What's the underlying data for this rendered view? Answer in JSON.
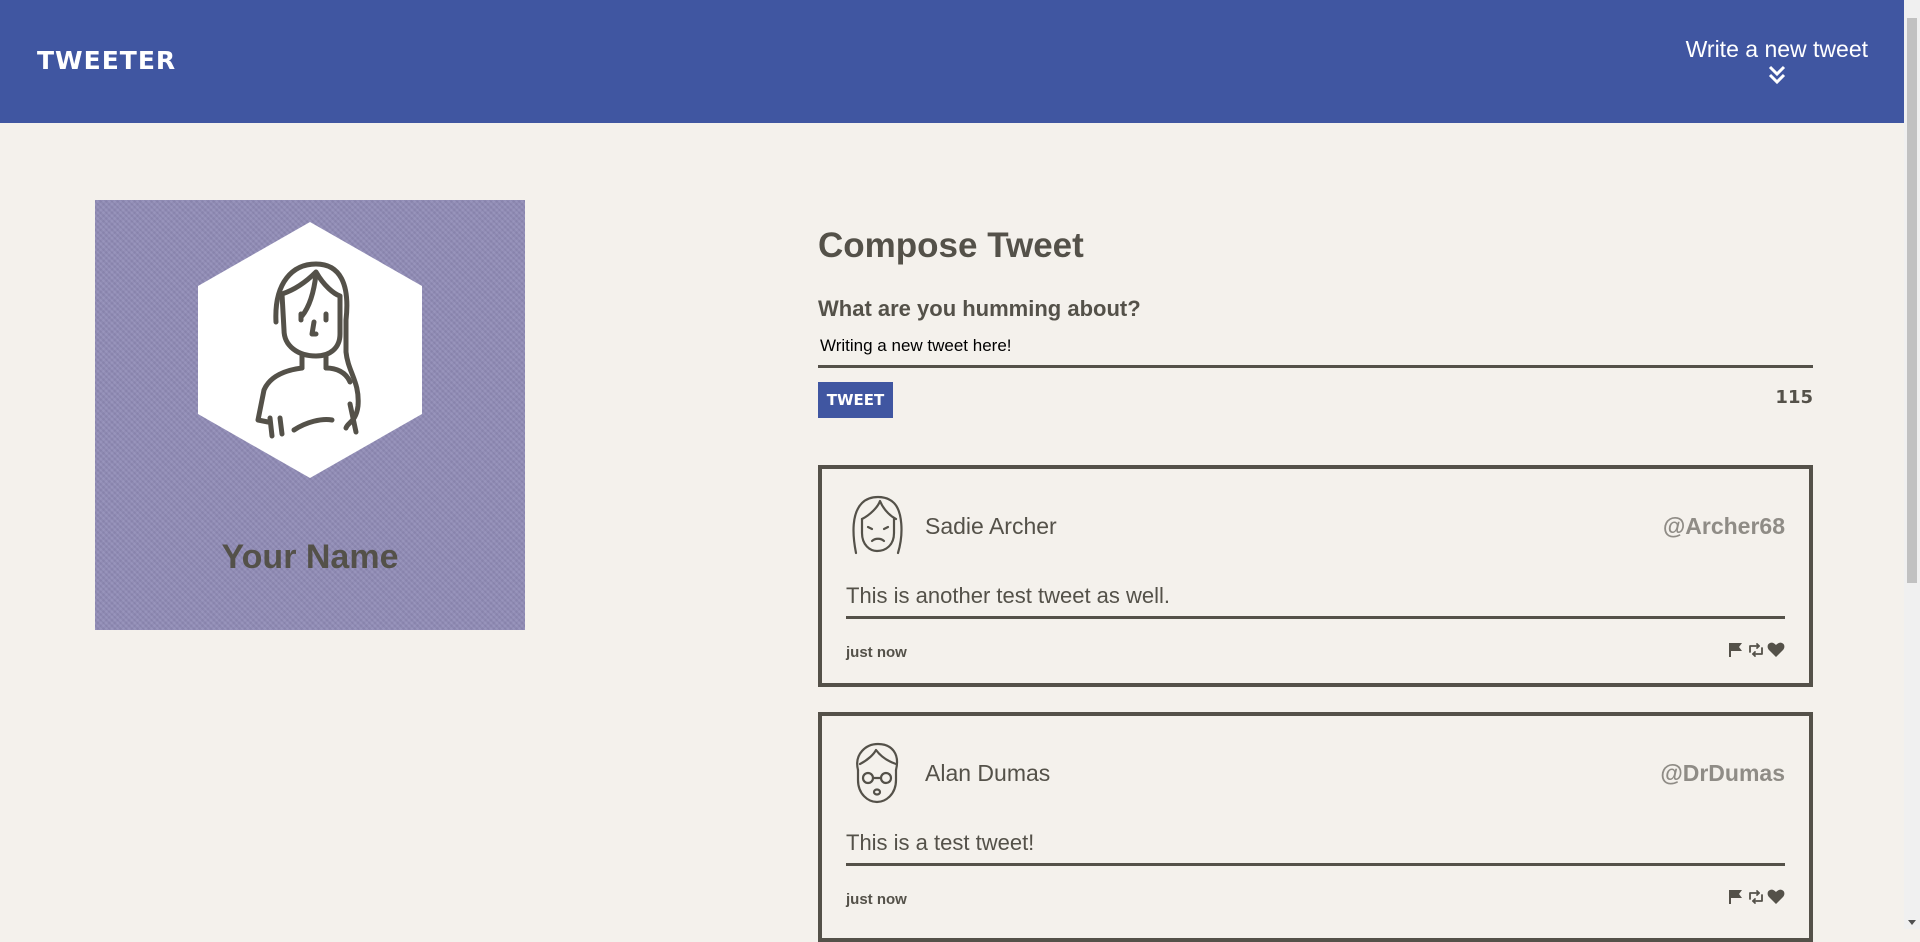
{
  "nav": {
    "brand": "TWEETER",
    "compose_label": "Write a new tweet",
    "compose_icon": "double-chevron-down-icon",
    "bg_color": "#4056a1"
  },
  "profile": {
    "name": "Your Name",
    "avatar_icon": "woman-avatar-icon",
    "card_color": "#8f8ab5"
  },
  "compose": {
    "title": "Compose Tweet",
    "prompt": "What are you humming about?",
    "text_value": "Writing a new tweet here!",
    "button_label": "TWEET",
    "counter": "115"
  },
  "tweets": [
    {
      "name": "Sadie Archer",
      "handle": "@Archer68",
      "content": "This is another test tweet as well.",
      "time": "just now",
      "avatar_icon": "girl-avatar-icon"
    },
    {
      "name": "Alan Dumas",
      "handle": "@DrDumas",
      "content": "This is a test tweet!",
      "time": "just now",
      "avatar_icon": "glasses-man-avatar-icon"
    }
  ],
  "colors": {
    "page_bg": "#f4f1ec",
    "text": "#545149",
    "accent": "#4056a1",
    "handle": "#8f8c86"
  }
}
